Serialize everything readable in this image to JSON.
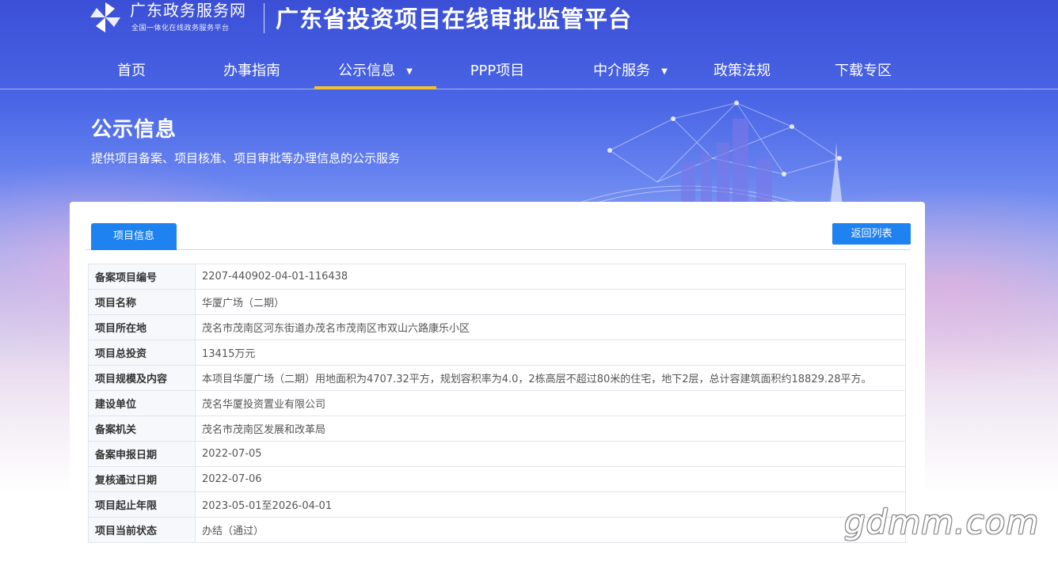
{
  "header": {
    "logo_title": "广东政务服务网",
    "logo_subtitle": "全国一体化在线政务服务平台",
    "platform_title": "广东省投资项目在线审批监管平台"
  },
  "nav": [
    {
      "label": "首页",
      "active": false,
      "dropdown": false
    },
    {
      "label": "办事指南",
      "active": false,
      "dropdown": false
    },
    {
      "label": "公示信息",
      "active": true,
      "dropdown": true
    },
    {
      "label": "PPP项目",
      "active": false,
      "dropdown": false
    },
    {
      "label": "中介服务",
      "active": false,
      "dropdown": true
    },
    {
      "label": "政策法规",
      "active": false,
      "dropdown": false
    },
    {
      "label": "下载专区",
      "active": false,
      "dropdown": false
    }
  ],
  "section": {
    "title": "公示信息",
    "description": "提供项目备案、项目核准、项目审批等办理信息的公示服务"
  },
  "panel": {
    "tab_label": "项目信息",
    "back_button": "返回列表"
  },
  "project_info": [
    {
      "label": "备案项目编号",
      "value": "2207-440902-04-01-116438"
    },
    {
      "label": "项目名称",
      "value": "华厦广场（二期）"
    },
    {
      "label": "项目所在地",
      "value": "茂名市茂南区河东街道办茂名市茂南区市双山六路康乐小区"
    },
    {
      "label": "项目总投资",
      "value": "13415万元"
    },
    {
      "label": "项目规模及内容",
      "value": "本项目华厦广场（二期）用地面积为4707.32平方，规划容积率为4.0，2栋高层不超过80米的住宅，地下2层，总计容建筑面积约18829.28平方。"
    },
    {
      "label": "建设单位",
      "value": "茂名华厦投资置业有限公司"
    },
    {
      "label": "备案机关",
      "value": "茂名市茂南区发展和改革局"
    },
    {
      "label": "备案申报日期",
      "value": "2022-07-05"
    },
    {
      "label": "复核通过日期",
      "value": "2022-07-06"
    },
    {
      "label": "项目起止年限",
      "value": "2023-05-01至2026-04-01"
    },
    {
      "label": "项目当前状态",
      "value": "办结（通过）"
    }
  ],
  "watermark": "gdmm.com",
  "colors": {
    "accent_blue": "#1e82f0",
    "nav_active_underline": "#f5c22c"
  }
}
